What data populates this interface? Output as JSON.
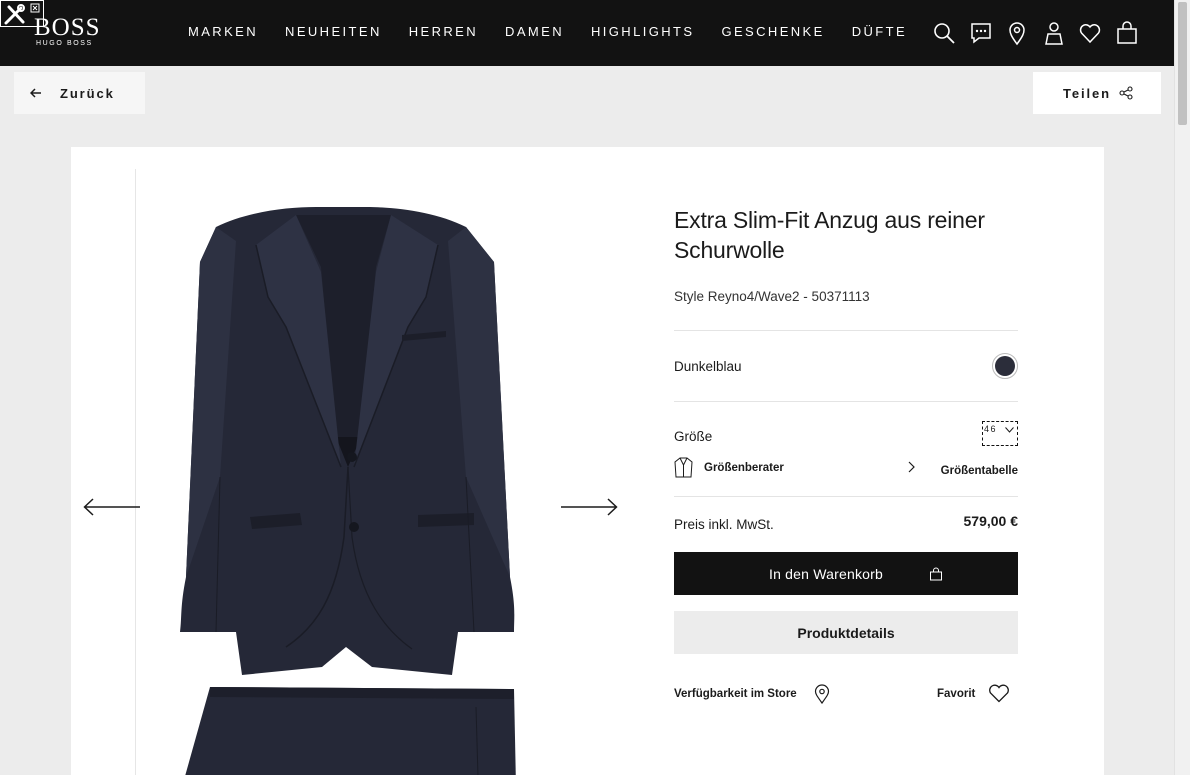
{
  "header": {
    "logo": {
      "main": "BOSS",
      "sub": "HUGO BOSS"
    },
    "nav": [
      "MARKEN",
      "NEUHEITEN",
      "HERREN",
      "DAMEN",
      "HIGHLIGHTS",
      "GESCHENKE",
      "DÜFTE"
    ],
    "icons": [
      "search-icon",
      "chat-icon",
      "location-pin-icon",
      "account-icon",
      "wishlist-heart-icon",
      "shopping-bag-icon"
    ]
  },
  "subbar": {
    "back_label": "Zurück",
    "share_label": "Teilen"
  },
  "product": {
    "title": "Extra Slim-Fit Anzug aus reiner Schurwolle",
    "style": "Style Reyno4/Wave2 - 50371113",
    "color_name": "Dunkelblau",
    "color_hex": "#2b2d3a",
    "size_label": "Größe",
    "size_value": "46",
    "size_advisor": "Größenberater",
    "size_chart": "Größentabelle",
    "price_label": "Preis inkl. MwSt.",
    "price": "579,00 €",
    "cart_button": "In den Warenkorb",
    "details_button": "Produktdetails",
    "store_availability": "Verfügbarkeit im Store",
    "favorite": "Favorit"
  },
  "colors": {
    "header_bg": "#121212",
    "page_bg": "#ececec",
    "accent": "#121212"
  }
}
